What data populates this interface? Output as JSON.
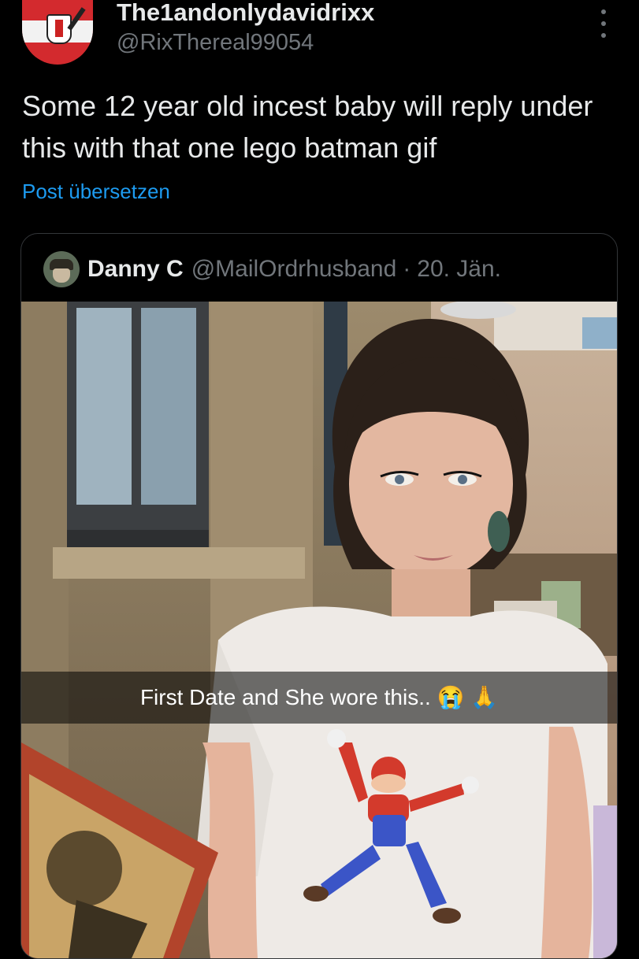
{
  "post": {
    "display_name": "The1andonlydavidrixx",
    "handle": "@RixThereal99054",
    "text": "Some 12 year old incest baby will reply under this with that one lego batman gif",
    "translate_label": "Post übersetzen",
    "more_icon": "more-options-icon"
  },
  "quoted": {
    "name": "Danny C",
    "handle": "@MailOrdrhusband",
    "separator": "·",
    "date": "20. Jän.",
    "caption": "First Date and She wore this.. 😭 🙏"
  },
  "colors": {
    "background": "#000000",
    "text": "#e7e9ea",
    "muted": "#71767b",
    "link": "#1d9bf0",
    "border": "#333639"
  }
}
